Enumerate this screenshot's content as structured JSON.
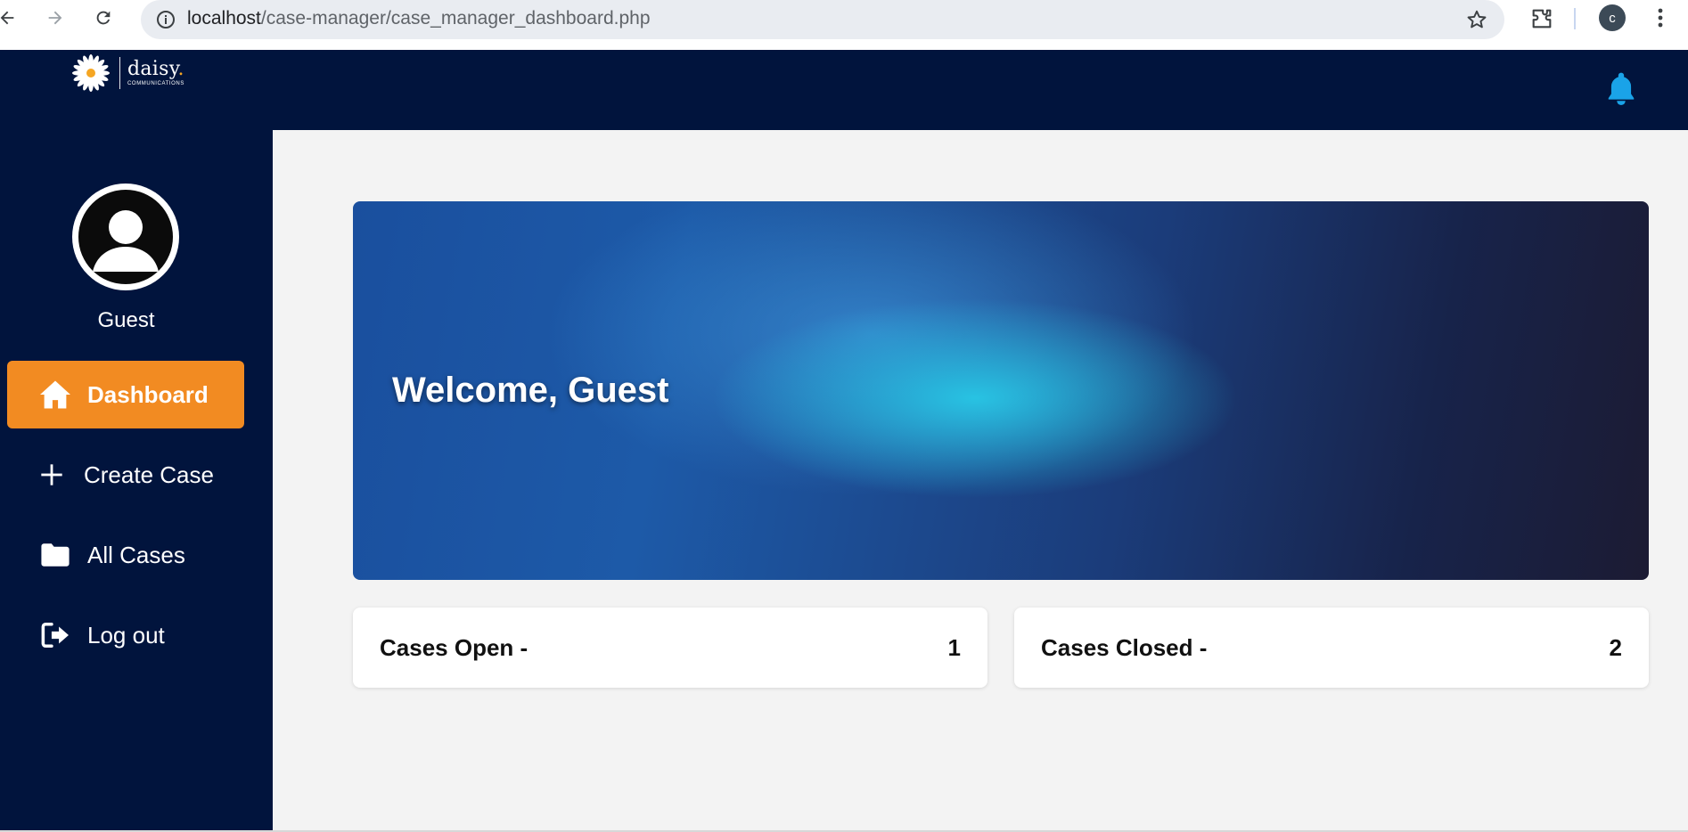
{
  "browser": {
    "url_host": "localhost",
    "url_path": "/case-manager/case_manager_dashboard.php",
    "profile_initial": "c"
  },
  "header": {
    "logo_name": "daisy",
    "logo_dot": ".",
    "logo_sub": "COMMUNICATIONS"
  },
  "sidebar": {
    "user_name": "Guest",
    "items": [
      {
        "label": "Dashboard",
        "icon": "home-icon",
        "active": true
      },
      {
        "label": "Create Case",
        "icon": "plus-icon",
        "active": false
      },
      {
        "label": "All Cases",
        "icon": "folder-icon",
        "active": false
      },
      {
        "label": "Log out",
        "icon": "logout-icon",
        "active": false
      }
    ]
  },
  "main": {
    "welcome": "Welcome, Guest",
    "stats": [
      {
        "label": "Cases Open -",
        "value": "1"
      },
      {
        "label": "Cases Closed -",
        "value": "2"
      }
    ]
  },
  "colors": {
    "navy": "#01143d",
    "accent": "#f28b22",
    "bell": "#1aa3e8",
    "background": "#f3f3f3"
  }
}
